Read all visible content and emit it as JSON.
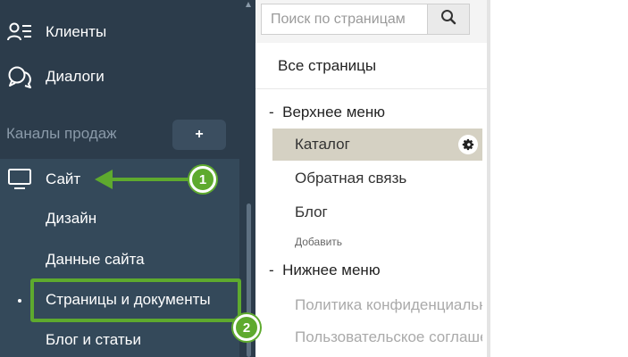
{
  "sidebar": {
    "items": [
      {
        "label": "Клиенты",
        "icon": "users-list-icon"
      },
      {
        "label": "Диалоги",
        "icon": "chat-bubbles-icon"
      }
    ],
    "sales_channels_label": "Каналы продаж",
    "add_channel_label": "+",
    "site": {
      "label": "Сайт",
      "icon": "monitor-icon",
      "subitems": [
        {
          "label": "Дизайн"
        },
        {
          "label": "Данные сайта"
        },
        {
          "label": "Страницы и документы"
        },
        {
          "label": "Блог и статьи"
        }
      ]
    }
  },
  "pages_panel": {
    "search": {
      "placeholder": "Поиск по страницам",
      "value": ""
    },
    "all_pages_label": "Все страницы",
    "top_menu": {
      "title": "Верхнее меню",
      "prefix": "-",
      "items": [
        {
          "label": "Каталог",
          "selected": true
        },
        {
          "label": "Обратная связь"
        },
        {
          "label": "Блог"
        }
      ],
      "add_label": "Добавить"
    },
    "bottom_menu": {
      "title": "Нижнее меню",
      "prefix": "-",
      "items": [
        {
          "label": "Политика конфиденциальности",
          "disabled": true
        },
        {
          "label": "Пользовательское соглашение",
          "disabled": true
        }
      ]
    }
  },
  "annotations": {
    "callout_1": "1",
    "callout_2": "2"
  },
  "colors": {
    "sidebar_bg": "#2c3c4b",
    "sidebar_sub_bg": "#34495a",
    "highlight_green": "#5eaa2e",
    "selected_bg": "#d5d1c3"
  }
}
